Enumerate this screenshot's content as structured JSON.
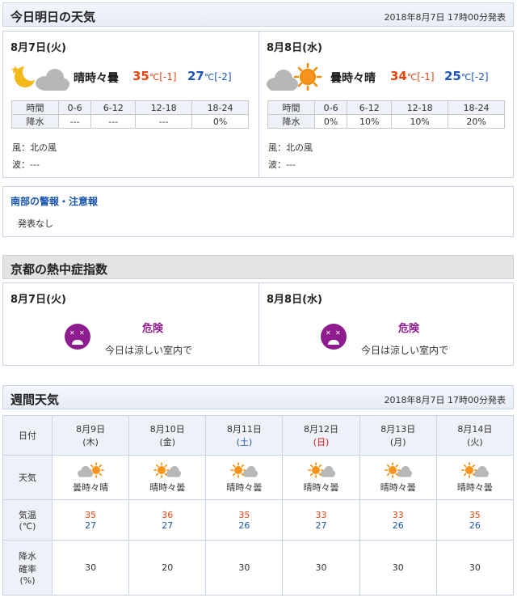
{
  "today_section": {
    "title": "今日明日の天気",
    "published": "2018年8月7日 17時00分発表",
    "days": [
      {
        "date": "8月7日(火)",
        "telop": "晴時々曇",
        "max_temp": "35",
        "max_diff": "[-1]",
        "min_temp": "27",
        "min_diff": "[-2]",
        "unit": "℃",
        "pop_header_label": "時間",
        "pop_periods": [
          "0-6",
          "6-12",
          "12-18",
          "18-24"
        ],
        "pop_row_label": "降水",
        "pop_values": [
          "---",
          "---",
          "---",
          "0%"
        ],
        "wind": "風：北の風",
        "wave": "波：---"
      },
      {
        "date": "8月8日(水)",
        "telop": "曇時々晴",
        "max_temp": "34",
        "max_diff": "[-1]",
        "min_temp": "25",
        "min_diff": "[-2]",
        "unit": "℃",
        "pop_header_label": "時間",
        "pop_periods": [
          "0-6",
          "6-12",
          "12-18",
          "18-24"
        ],
        "pop_row_label": "降水",
        "pop_values": [
          "0%",
          "10%",
          "10%",
          "20%"
        ],
        "wind": "風：北の風",
        "wave": "波：---"
      }
    ]
  },
  "warning": {
    "title": "南部の警報・注意報",
    "text": "発表なし"
  },
  "heat_section": {
    "title": "京都の熱中症指数",
    "days": [
      {
        "date": "8月7日(火)",
        "level": "危険",
        "advice": "今日は涼しい室内で"
      },
      {
        "date": "8月8日(水)",
        "level": "危険",
        "advice": "今日は涼しい室内で"
      }
    ]
  },
  "weekly_section": {
    "title": "週間天気",
    "published": "2018年8月7日 17時00分発表",
    "row_labels": {
      "date": "日付",
      "weather": "天気",
      "temp_line1": "気温",
      "temp_line2": "(℃)",
      "pop_line1": "降水",
      "pop_line2": "確率",
      "pop_line3": "(%)"
    },
    "days": [
      {
        "date": "8月9日",
        "dow": "(木)",
        "dow_type": "weekday",
        "weather": "曇時々晴",
        "icon": "cloud-sun-icon",
        "hi": "35",
        "lo": "27",
        "pop": "30"
      },
      {
        "date": "8月10日",
        "dow": "(金)",
        "dow_type": "weekday",
        "weather": "晴時々曇",
        "icon": "sun-cloud-icon",
        "hi": "36",
        "lo": "27",
        "pop": "20"
      },
      {
        "date": "8月11日",
        "dow": "(土)",
        "dow_type": "sat",
        "weather": "晴時々曇",
        "icon": "sun-cloud-icon",
        "hi": "35",
        "lo": "26",
        "pop": "30"
      },
      {
        "date": "8月12日",
        "dow": "(日)",
        "dow_type": "sun",
        "weather": "晴時々曇",
        "icon": "sun-cloud-icon",
        "hi": "33",
        "lo": "27",
        "pop": "30"
      },
      {
        "date": "8月13日",
        "dow": "(月)",
        "dow_type": "weekday",
        "weather": "晴時々曇",
        "icon": "sun-cloud-icon",
        "hi": "33",
        "lo": "26",
        "pop": "30"
      },
      {
        "date": "8月14日",
        "dow": "(火)",
        "dow_type": "weekday",
        "weather": "晴時々曇",
        "icon": "sun-cloud-icon",
        "hi": "35",
        "lo": "26",
        "pop": "30"
      }
    ]
  },
  "colors": {
    "max": "#e8460f",
    "min": "#1e54b8",
    "heat_danger": "#8e1c8e",
    "link": "#1a56b0"
  }
}
